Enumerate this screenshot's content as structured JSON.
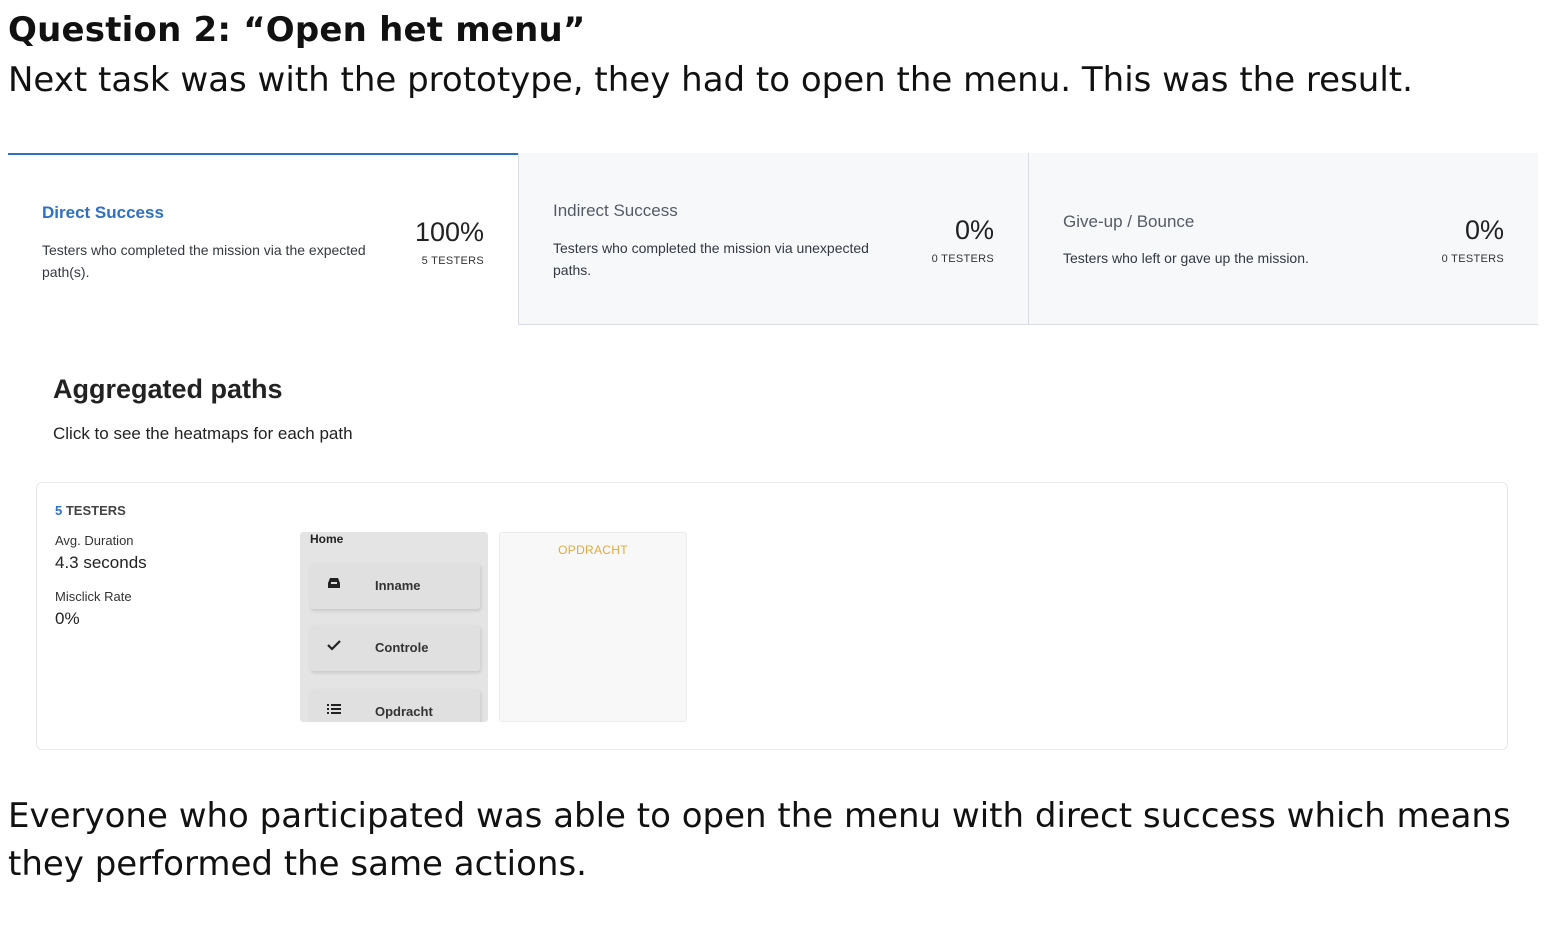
{
  "document": {
    "heading": "Question 2: “Open het menu”",
    "intro": "Next task was with the prototype, they had to open the menu. This was the result.",
    "conclusion": "Everyone who participated was able to open the menu with direct success which means they performed the same actions."
  },
  "stats": [
    {
      "title": "Direct Success",
      "description": "Testers who completed the mission via the expected path(s).",
      "value": "100%",
      "testers": "5 TESTERS",
      "active": true,
      "accent": "#2f6fc4"
    },
    {
      "title": "Indirect Success",
      "description": "Testers who completed the mission via unexpected paths.",
      "value": "0%",
      "testers": "0 TESTERS",
      "active": false
    },
    {
      "title": "Give-up / Bounce",
      "description": "Testers who left or gave up the mission.",
      "value": "0%",
      "testers": "0 TESTERS",
      "active": false
    }
  ],
  "aggregated": {
    "title": "Aggregated paths",
    "subtitle": "Click to see the heatmaps for each path",
    "path": {
      "tester_count": "5",
      "tester_label": "TESTERS",
      "avg_duration_label": "Avg. Duration",
      "avg_duration_value": "4.3 seconds",
      "misclick_label": "Misclick Rate",
      "misclick_value": "0%",
      "screens": {
        "menu": {
          "home_label": "Home",
          "items": [
            {
              "label": "Inname",
              "icon": "inbox-icon"
            },
            {
              "label": "Controle",
              "icon": "check-icon"
            },
            {
              "label": "Opdracht",
              "icon": "list-icon"
            }
          ]
        },
        "task": {
          "label": "OPDRACHT",
          "color": "#e3a93b"
        }
      }
    }
  }
}
